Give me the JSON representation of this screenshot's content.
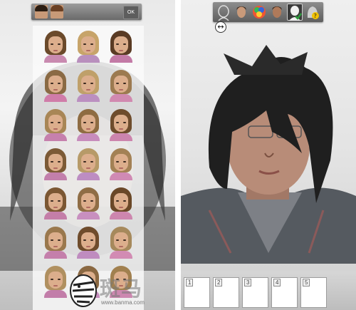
{
  "left_screen": {
    "top_bar": {
      "ok_label": "OK"
    },
    "catalog": {
      "columns": 3,
      "thumbnails": [
        {
          "hair": "#6b4a2b",
          "shirt": "#c98ab0"
        },
        {
          "hair": "#c7a46a",
          "shirt": "#b98fbd"
        },
        {
          "hair": "#5a3b24",
          "shirt": "#c37aa6"
        },
        {
          "hair": "#8a6a44",
          "shirt": "#d07ca9"
        },
        {
          "hair": "#bfa06a",
          "shirt": "#bb8fc0"
        },
        {
          "hair": "#9c7a50",
          "shirt": "#d189b0"
        },
        {
          "hair": "#a88656",
          "shirt": "#c680ad"
        },
        {
          "hair": "#8e6c42",
          "shirt": "#c78cbc"
        },
        {
          "hair": "#6e4c2c",
          "shirt": "#cc84ad"
        },
        {
          "hair": "#7c5a36",
          "shirt": "#c27fab"
        },
        {
          "hair": "#b79a68",
          "shirt": "#bd8dc2"
        },
        {
          "hair": "#a38155",
          "shirt": "#d08ab4"
        },
        {
          "hair": "#7b5733",
          "shirt": "#c47ea8"
        },
        {
          "hair": "#8f6d45",
          "shirt": "#c88fbf"
        },
        {
          "hair": "#6a4828",
          "shirt": "#cd86ae"
        },
        {
          "hair": "#9a784d",
          "shirt": "#c47fab"
        },
        {
          "hair": "#6f4c2c",
          "shirt": "#bf8cbf"
        },
        {
          "hair": "#a6895c",
          "shirt": "#d28bb3"
        },
        {
          "hair": "#b09060",
          "shirt": "#c27da9"
        },
        {
          "hair": "#8a6842",
          "shirt": "#c58dbd"
        },
        {
          "hair": "#a1804f",
          "shirt": "#cd88b0"
        }
      ]
    }
  },
  "right_screen": {
    "toolbar": {
      "tools": [
        {
          "name": "head-outline-icon"
        },
        {
          "name": "faces-icon"
        },
        {
          "name": "color-palette-icon"
        },
        {
          "name": "model-face-icon"
        },
        {
          "name": "confirm-silhouette-icon",
          "selected": true
        },
        {
          "name": "help-icon"
        }
      ]
    },
    "resize_handle_glyph": "↔",
    "slots": [
      {
        "number": "1"
      },
      {
        "number": "2"
      },
      {
        "number": "3"
      },
      {
        "number": "4"
      },
      {
        "number": "5"
      }
    ]
  },
  "watermark": {
    "brand": "斑马",
    "url": "www.banma.com"
  }
}
